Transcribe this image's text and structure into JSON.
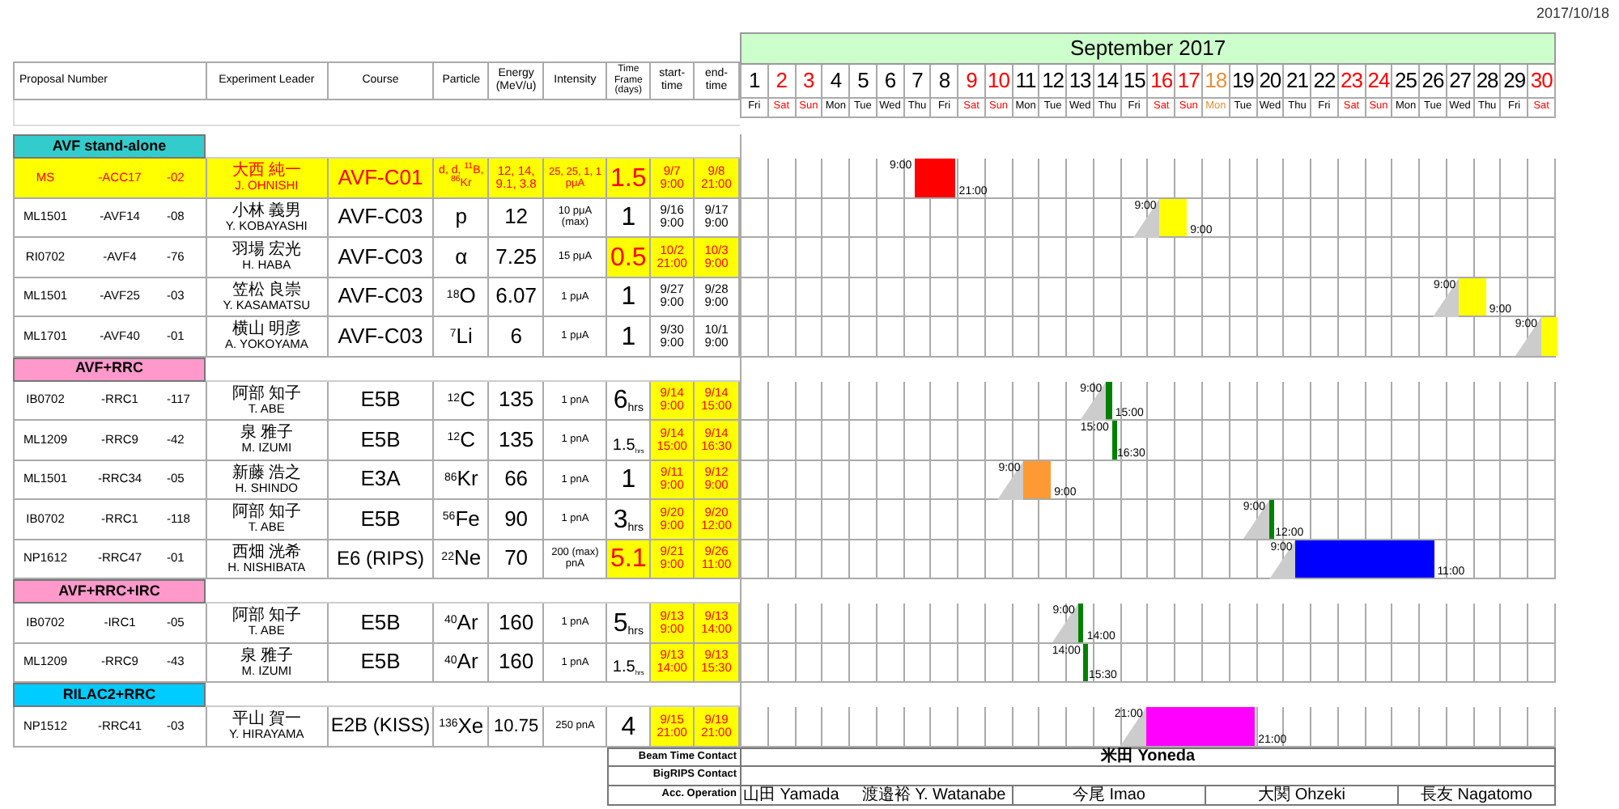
{
  "date": "2017/10/18",
  "columns": [
    "Proposal Number",
    "Experiment Leader",
    "Course",
    "Particle",
    "Energy (MeV/u)",
    "Intensity",
    "Time Frame (days)",
    "start-time",
    "end-time"
  ],
  "calendar": {
    "month": "September 2017",
    "days": [
      {
        "day": "1",
        "weekday": "Fri",
        "color": "#000000"
      },
      {
        "day": "2",
        "weekday": "Sat",
        "color": "#ff0000"
      },
      {
        "day": "3",
        "weekday": "Sun",
        "color": "#ff0000"
      },
      {
        "day": "4",
        "weekday": "Mon",
        "color": "#000000"
      },
      {
        "day": "5",
        "weekday": "Tue",
        "color": "#000000"
      },
      {
        "day": "6",
        "weekday": "Wed",
        "color": "#000000"
      },
      {
        "day": "7",
        "weekday": "Thu",
        "color": "#000000"
      },
      {
        "day": "8",
        "weekday": "Fri",
        "color": "#000000"
      },
      {
        "day": "9",
        "weekday": "Sat",
        "color": "#ff0000"
      },
      {
        "day": "10",
        "weekday": "Sun",
        "color": "#ff0000"
      },
      {
        "day": "11",
        "weekday": "Mon",
        "color": "#000000"
      },
      {
        "day": "12",
        "weekday": "Tue",
        "color": "#000000"
      },
      {
        "day": "13",
        "weekday": "Wed",
        "color": "#000000"
      },
      {
        "day": "14",
        "weekday": "Thu",
        "color": "#000000"
      },
      {
        "day": "15",
        "weekday": "Fri",
        "color": "#000000"
      },
      {
        "day": "16",
        "weekday": "Sat",
        "color": "#ff0000"
      },
      {
        "day": "17",
        "weekday": "Sun",
        "color": "#ff0000"
      },
      {
        "day": "18",
        "weekday": "Mon",
        "color": "#e69138"
      },
      {
        "day": "19",
        "weekday": "Tue",
        "color": "#000000"
      },
      {
        "day": "20",
        "weekday": "Wed",
        "color": "#000000"
      },
      {
        "day": "21",
        "weekday": "Thu",
        "color": "#000000"
      },
      {
        "day": "22",
        "weekday": "Fri",
        "color": "#000000"
      },
      {
        "day": "23",
        "weekday": "Sat",
        "color": "#ff0000"
      },
      {
        "day": "24",
        "weekday": "Sun",
        "color": "#ff0000"
      },
      {
        "day": "25",
        "weekday": "Mon",
        "color": "#000000"
      },
      {
        "day": "26",
        "weekday": "Tue",
        "color": "#000000"
      },
      {
        "day": "27",
        "weekday": "Wed",
        "color": "#000000"
      },
      {
        "day": "28",
        "weekday": "Thu",
        "color": "#000000"
      },
      {
        "day": "29",
        "weekday": "Fri",
        "color": "#000000"
      },
      {
        "day": "30",
        "weekday": "Sat",
        "color": "#ff0000"
      }
    ]
  },
  "sections": [
    {
      "title": "AVF stand-alone",
      "color": "#33cccc",
      "rows": [
        {
          "proposal": [
            "MS",
            "-ACC17",
            "-02"
          ],
          "leader_ja": "大西 純一",
          "leader_en": "J. OHNISHI",
          "course": "AVF-C01",
          "particle": "d, d, $^{11}$B, $^{86}$Kr",
          "energy": "12, 14, 9.1, 3.8",
          "intensity": "25, 25, 1, 1 pμA",
          "time_frame": "1.5",
          "start": {
            "date": "9/7",
            "time": "9:00"
          },
          "end": {
            "date": "9/8",
            "time": "21:00"
          },
          "row_highlighted": true,
          "time_frame_highlighted": true,
          "dates_highlighted": true,
          "bar": {
            "color": "#ff0000",
            "ramp": false,
            "start_label": "9:00",
            "end_label": "21:00"
          }
        },
        {
          "proposal": [
            "ML1501",
            "-AVF14",
            "-08"
          ],
          "leader_ja": "小林 義男",
          "leader_en": "Y. KOBAYASHI",
          "course": "AVF-C03",
          "particle": "p",
          "energy": "12",
          "intensity": "10 pμA (max)",
          "time_frame": "1",
          "start": {
            "date": "9/16",
            "time": "9:00"
          },
          "end": {
            "date": "9/17",
            "time": "9:00"
          },
          "row_highlighted": false,
          "time_frame_highlighted": false,
          "dates_highlighted": false,
          "bar": {
            "color": "#ffff00",
            "ramp": true,
            "start_label": "9:00",
            "end_label": "9:00"
          }
        },
        {
          "proposal": [
            "RI0702",
            "-AVF4",
            "-76"
          ],
          "leader_ja": "羽場 宏光",
          "leader_en": "H. HABA",
          "course": "AVF-C03",
          "particle": "α",
          "energy": "7.25",
          "intensity": "15 pμA",
          "time_frame": "0.5",
          "start": {
            "date": "10/2",
            "time": "21:00"
          },
          "end": {
            "date": "10/3",
            "time": "9:00"
          },
          "row_highlighted": false,
          "time_frame_highlighted": true,
          "dates_highlighted": true
        },
        {
          "proposal": [
            "ML1501",
            "-AVF25",
            "-03"
          ],
          "leader_ja": "笠松 良崇",
          "leader_en": "Y. KASAMATSU",
          "course": "AVF-C03",
          "particle": "$^{18}$O",
          "energy": "6.07",
          "intensity": "1 pμA",
          "time_frame": "1",
          "start": {
            "date": "9/27",
            "time": "9:00"
          },
          "end": {
            "date": "9/28",
            "time": "9:00"
          },
          "row_highlighted": false,
          "time_frame_highlighted": false,
          "dates_highlighted": false,
          "bar": {
            "color": "#ffff00",
            "ramp": true,
            "start_label": "9:00",
            "end_label": "9:00"
          }
        },
        {
          "proposal": [
            "ML1701",
            "-AVF40",
            "-01"
          ],
          "leader_ja": "横山 明彦",
          "leader_en": "A. YOKOYAMA",
          "course": "AVF-C03",
          "particle": "$^{7}$Li",
          "energy": "6",
          "intensity": "1 pμA",
          "time_frame": "1",
          "start": {
            "date": "9/30",
            "time": "9:00"
          },
          "end": {
            "date": "10/1",
            "time": "9:00"
          },
          "row_highlighted": false,
          "time_frame_highlighted": false,
          "dates_highlighted": false,
          "bar": {
            "color": "#ffff00",
            "ramp": true,
            "start_label": "9:00"
          }
        }
      ]
    },
    {
      "title": "AVF+RRC",
      "color": "#ff99cc",
      "rows": [
        {
          "proposal": [
            "IB0702",
            "-RRC1",
            "-117"
          ],
          "leader_ja": "阿部 知子",
          "leader_en": "T. ABE",
          "course": "E5B",
          "particle": "$^{12}$C",
          "energy": "135",
          "intensity": "1 pnA",
          "time_frame": "6",
          "time_unit": "hrs",
          "start": {
            "date": "9/14",
            "time": "9:00"
          },
          "end": {
            "date": "9/14",
            "time": "15:00"
          },
          "row_highlighted": false,
          "time_frame_highlighted": false,
          "dates_highlighted": true,
          "bar": {
            "color": "#008000",
            "ramp": true,
            "start_label": "9:00",
            "end_label": "15:00"
          }
        },
        {
          "proposal": [
            "ML1209",
            "-RRC9",
            "-42"
          ],
          "leader_ja": "泉 雅子",
          "leader_en": "M. IZUMI",
          "course": "E5B",
          "particle": "$^{12}$C",
          "energy": "135",
          "intensity": "1 pnA",
          "time_frame": "1.5",
          "time_unit": "hrs",
          "start": {
            "date": "9/14",
            "time": "15:00"
          },
          "end": {
            "date": "9/14",
            "time": "16:30"
          },
          "row_highlighted": false,
          "time_frame_highlighted": false,
          "dates_highlighted": true,
          "bar": {
            "color": "#008000",
            "ramp": false,
            "start_label": "15:00",
            "end_label": "16:30"
          }
        },
        {
          "proposal": [
            "ML1501",
            "-RRC34",
            "-05"
          ],
          "leader_ja": "新藤 浩之",
          "leader_en": "H. SHINDO",
          "course": "E3A",
          "particle": "$^{86}$Kr",
          "energy": "66",
          "intensity": "1 pnA",
          "time_frame": "1",
          "start": {
            "date": "9/11",
            "time": "9:00"
          },
          "end": {
            "date": "9/12",
            "time": "9:00"
          },
          "row_highlighted": false,
          "time_frame_highlighted": false,
          "dates_highlighted": true,
          "bar": {
            "color": "#ff9933",
            "ramp": true,
            "start_label": "9:00",
            "end_label": "9:00"
          }
        },
        {
          "proposal": [
            "IB0702",
            "-RRC1",
            "-118"
          ],
          "leader_ja": "阿部 知子",
          "leader_en": "T. ABE",
          "course": "E5B",
          "particle": "$^{56}$Fe",
          "energy": "90",
          "intensity": "1 pnA",
          "time_frame": "3",
          "time_unit": "hrs",
          "start": {
            "date": "9/20",
            "time": "9:00"
          },
          "end": {
            "date": "9/20",
            "time": "12:00"
          },
          "row_highlighted": false,
          "time_frame_highlighted": false,
          "dates_highlighted": true,
          "bar": {
            "color": "#008000",
            "ramp": true,
            "start_label": "9:00",
            "end_label": "12:00"
          }
        },
        {
          "proposal": [
            "NP1612",
            "-RRC47",
            "-01"
          ],
          "leader_ja": "西畑 洸希",
          "leader_en": "H. NISHIBATA",
          "course": "E6 (RIPS)",
          "particle": "$^{22}$Ne",
          "energy": "70",
          "intensity": "200 (max) pnA",
          "time_frame": "5.1",
          "start": {
            "date": "9/21",
            "time": "9:00"
          },
          "end": {
            "date": "9/26",
            "time": "11:00"
          },
          "row_highlighted": false,
          "time_frame_highlighted": true,
          "dates_highlighted": true,
          "bar": {
            "color": "#0000ff",
            "ramp": true,
            "start_label": "9:00",
            "end_label": "11:00"
          }
        }
      ]
    },
    {
      "title": "AVF+RRC+IRC",
      "color": "#ff99cc",
      "rows": [
        {
          "proposal": [
            "IB0702",
            "-IRC1",
            "-05"
          ],
          "leader_ja": "阿部 知子",
          "leader_en": "T. ABE",
          "course": "E5B",
          "particle": "$^{40}$Ar",
          "energy": "160",
          "intensity": "1 pnA",
          "time_frame": "5",
          "time_unit": "hrs",
          "start": {
            "date": "9/13",
            "time": "9:00"
          },
          "end": {
            "date": "9/13",
            "time": "14:00"
          },
          "row_highlighted": false,
          "time_frame_highlighted": false,
          "dates_highlighted": true,
          "bar": {
            "color": "#008000",
            "ramp": true,
            "start_label": "9:00",
            "end_label": "14:00"
          }
        },
        {
          "proposal": [
            "ML1209",
            "-RRC9",
            "-43"
          ],
          "leader_ja": "泉 雅子",
          "leader_en": "M. IZUMI",
          "course": "E5B",
          "particle": "$^{40}$Ar",
          "energy": "160",
          "intensity": "1 pnA",
          "time_frame": "1.5",
          "time_unit": "hrs",
          "start": {
            "date": "9/13",
            "time": "14:00"
          },
          "end": {
            "date": "9/13",
            "time": "15:30"
          },
          "row_highlighted": false,
          "time_frame_highlighted": false,
          "dates_highlighted": true,
          "bar": {
            "color": "#008000",
            "ramp": false,
            "start_label": "14:00",
            "end_label": "15:30"
          }
        }
      ]
    },
    {
      "title": "RILAC2+RRC",
      "color": "#00ccff",
      "rows": [
        {
          "proposal": [
            "NP1512",
            "-RRC41",
            "-03"
          ],
          "leader_ja": "平山 賀一",
          "leader_en": "Y. HIRAYAMA",
          "course": "E2B (KISS)",
          "particle": "$^{136}$Xe",
          "energy": "10.75",
          "intensity": "250 pnA",
          "time_frame": "4",
          "start": {
            "date": "9/15",
            "time": "21:00"
          },
          "end": {
            "date": "9/19",
            "time": "21:00"
          },
          "row_highlighted": false,
          "time_frame_highlighted": false,
          "dates_highlighted": true,
          "bar": {
            "color": "#ff00ff",
            "ramp": true,
            "start_label": "21:00",
            "end_label": "21:00"
          }
        }
      ]
    }
  ],
  "footer": {
    "beam_time_contact": {
      "label": "Beam Time Contact",
      "value": "米田 Yoneda"
    },
    "bigrips_contact": {
      "label": "BigRIPS Contact"
    },
    "acc_operation": {
      "label": "Acc. Operation",
      "segments": [
        {
          "names": [
            "山田 Yamada",
            "渡邉裕 Y. Watanabe"
          ]
        },
        {
          "names": [
            "今尾 Imao"
          ]
        },
        {
          "names": [
            "大関 Ohzeki"
          ]
        },
        {
          "names": [
            "長友 Nagatomo"
          ]
        }
      ]
    }
  }
}
